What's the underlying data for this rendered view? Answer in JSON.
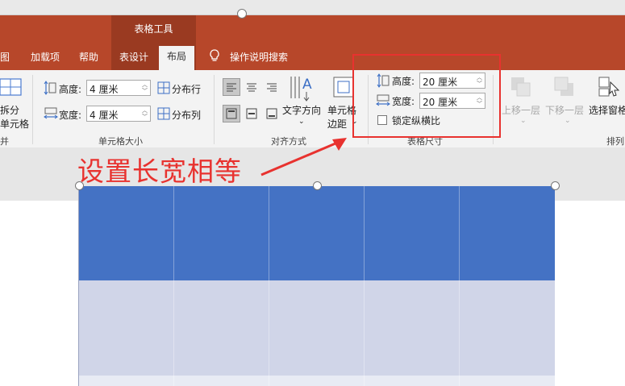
{
  "context_tab_group": "表格工具",
  "tabs": [
    {
      "label": "视图",
      "display": "图"
    },
    {
      "label": "加载项"
    },
    {
      "label": "帮助"
    },
    {
      "label": "表设计"
    },
    {
      "label": "布局",
      "active": true
    }
  ],
  "tell_me": "操作说明搜索",
  "ribbon": {
    "split_cells": {
      "line1": "拆分",
      "line2": "单元格"
    },
    "merge_group_label": "并",
    "cell_size": {
      "height_label": "高度:",
      "height_value": "4 厘米",
      "width_label": "宽度:",
      "width_value": "4 厘米",
      "distribute_rows": "分布行",
      "distribute_cols": "分布列",
      "group_label": "单元格大小"
    },
    "alignment": {
      "text_direction": "文字方向",
      "cell_margins_line1": "单元格",
      "cell_margins_line2": "边距",
      "group_label": "对齐方式"
    },
    "table_size": {
      "height_label": "高度:",
      "height_value": "20 厘米",
      "width_label": "宽度:",
      "width_value": "20 厘米",
      "lock_aspect": "锁定纵横比",
      "lock_checked": false,
      "group_label": "表格尺寸"
    },
    "arrange": {
      "bring_forward": "上移一层",
      "send_backward": "下移一层",
      "selection_pane": "选择窗格",
      "group_label": "排列"
    }
  },
  "annotation": "设置长宽相等",
  "colors": {
    "ribbon_red": "#b7472a",
    "highlight": "#e8322f",
    "table_header": "#4472c4",
    "table_row": "#d0d5e8"
  }
}
